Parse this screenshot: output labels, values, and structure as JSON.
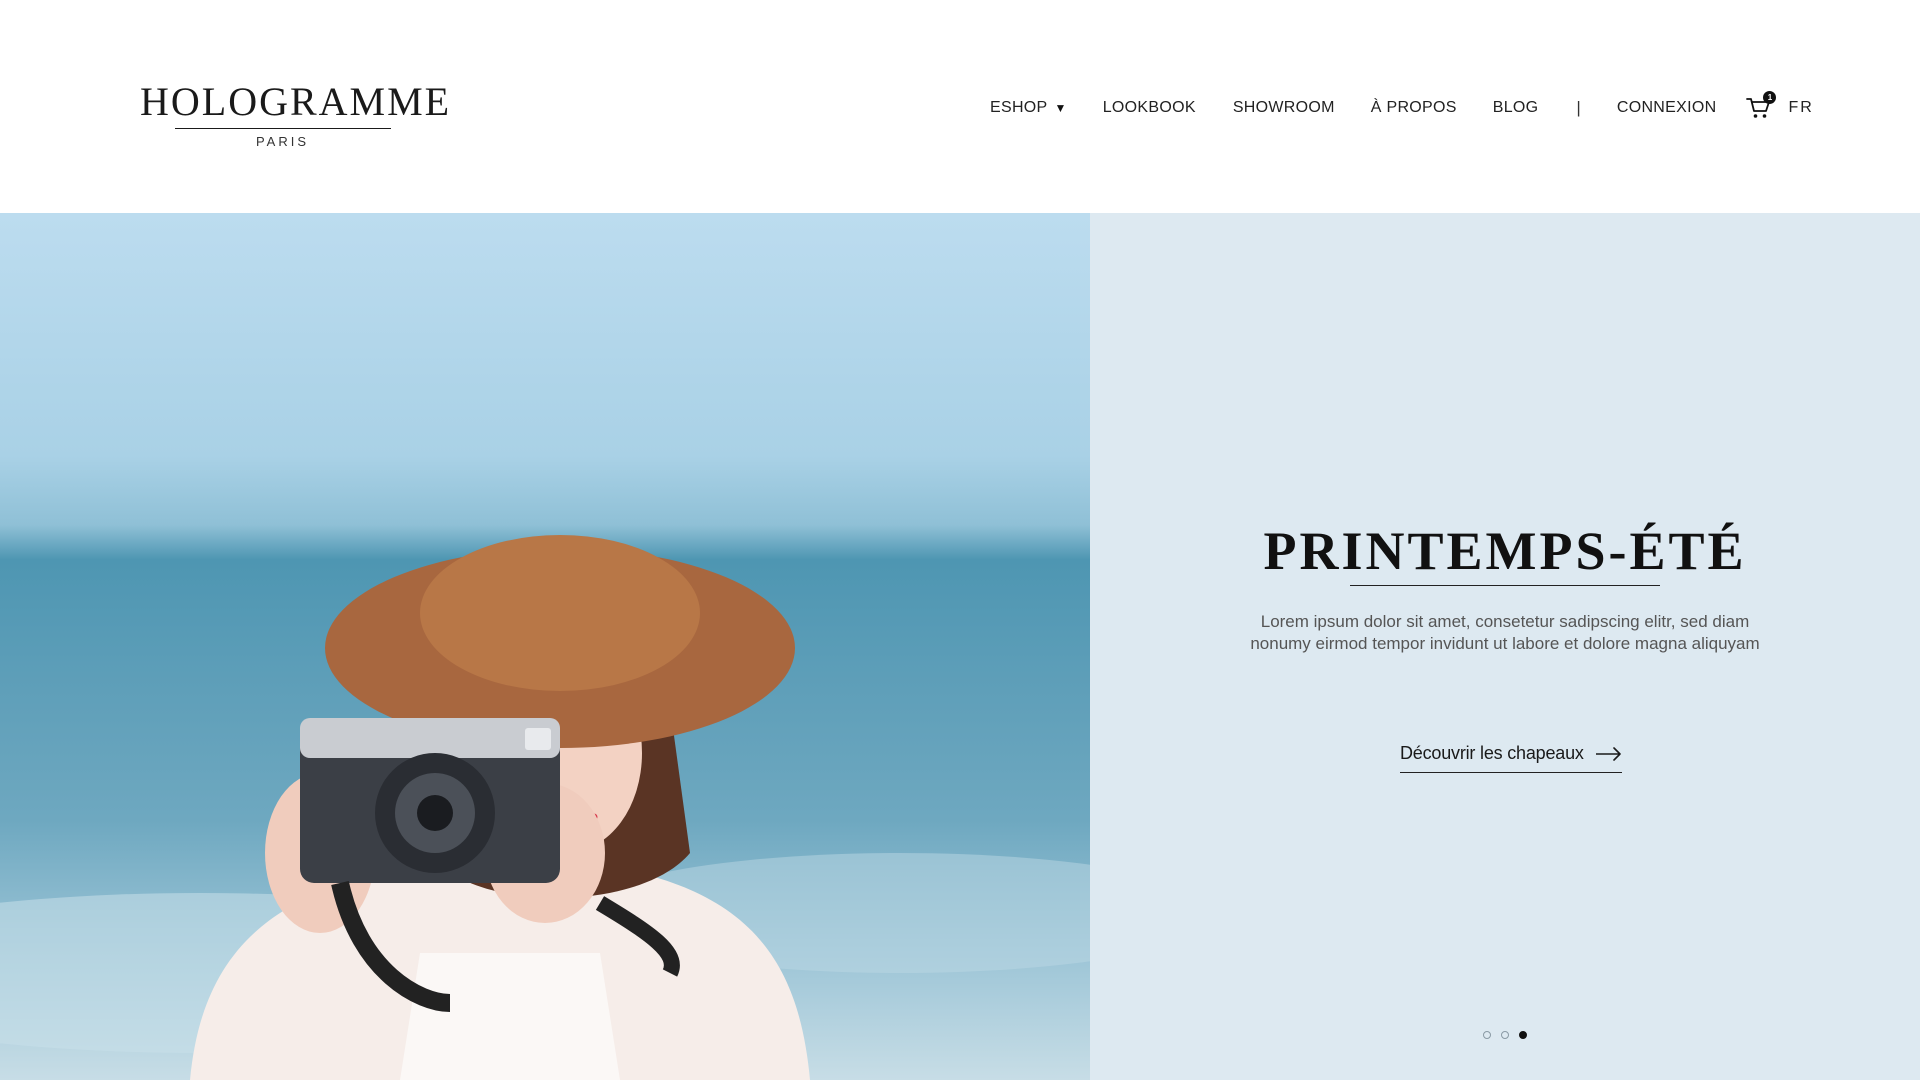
{
  "brand": {
    "name": "HOLOGRAMME",
    "subtitle": "PARIS"
  },
  "nav": {
    "items": [
      {
        "label": "ESHOP",
        "has_dropdown": true
      },
      {
        "label": "LOOKBOOK"
      },
      {
        "label": "SHOWROOM"
      },
      {
        "label": "À PROPOS"
      },
      {
        "label": "BLOG"
      }
    ],
    "divider": "|",
    "login": "CONNEXION",
    "cart": {
      "icon": "cart-icon",
      "count": "1"
    },
    "language": "FR"
  },
  "hero": {
    "title": "PRINTEMPS-ÉTÉ",
    "text": "Lorem ipsum dolor sit amet, consetetur sadipscing elitr, sed diam nonumy eirmod tempor invidunt ut labore et dolore magna aliquyam",
    "cta": {
      "label": "Découvrir les chapeaux",
      "icon": "arrow-right-icon"
    },
    "slides": {
      "total": 3,
      "active": 3
    }
  },
  "colors": {
    "panel": "#dde9f1",
    "text": "#1c1c1c",
    "muted": "#555555"
  }
}
